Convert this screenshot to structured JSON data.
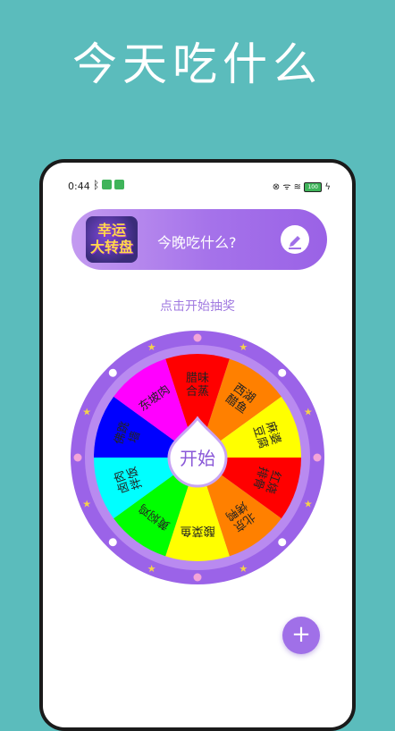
{
  "headline": "今天吃什么",
  "status": {
    "time": "0:44",
    "bluetooth": "ᛒ",
    "badge": "⊡",
    "signal": "⊗ ᯤ ≋",
    "battery": "100",
    "extra": "ϟ"
  },
  "banner": {
    "logo_text": "幸运\n大转盘",
    "title": "今晚吃什么?"
  },
  "hint": "点击开始抽奖",
  "start_label": "开始",
  "segments": [
    {
      "label": "腊味\n合蒸",
      "color": "#ff0000"
    },
    {
      "label": "西湖\n醋鱼",
      "color": "#ff8000"
    },
    {
      "label": "麻婆\n豆腐",
      "color": "#ffff00"
    },
    {
      "label": "红烧\n排骨",
      "color": "#ff0000"
    },
    {
      "label": "北京\n烤鸭",
      "color": "#ff8000"
    },
    {
      "label": "酸菜鱼",
      "color": "#ffff00"
    },
    {
      "label": "黄焖鸡",
      "color": "#00ff00"
    },
    {
      "label": "卤肉\n拌饭",
      "color": "#00ffff"
    },
    {
      "label": "佛跳\n墙",
      "color": "#0000ff"
    },
    {
      "label": "东坡肉",
      "color": "#ff00ff"
    }
  ],
  "colors": {
    "wheel_rim": "#9b63e8",
    "wheel_rim_inner": "#b98af0",
    "accent": "#a070e8",
    "star": "#f5d34a",
    "dot": "#f3a4d8"
  },
  "icons": {
    "edit": "edit-pencil-icon",
    "add": "plus-icon"
  }
}
